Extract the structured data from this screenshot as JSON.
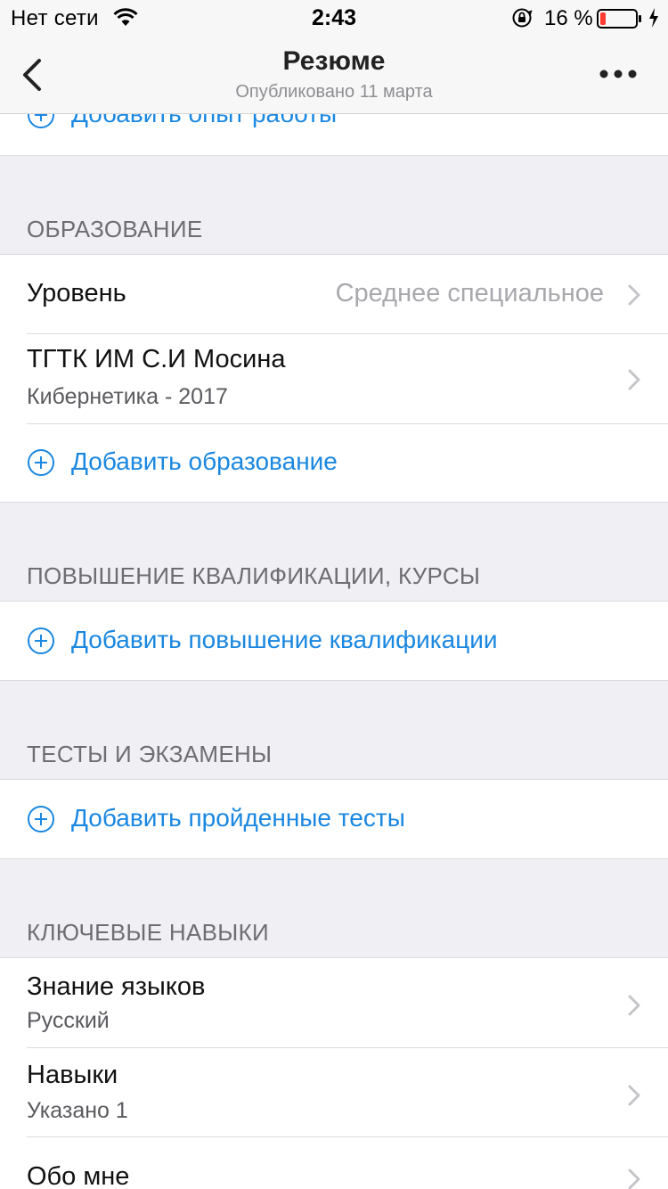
{
  "status": {
    "carrier": "Нет сети",
    "time": "2:43",
    "battery_percent": "16 %",
    "battery_level": 0.16,
    "battery_color": "#ff3b30"
  },
  "nav": {
    "title": "Резюме",
    "subtitle": "Опубликовано 11 марта"
  },
  "experience": {
    "add_label": "Добавить опыт работы"
  },
  "education": {
    "header": "ОБРАЗОВАНИЕ",
    "level_label": "Уровень",
    "level_value": "Среднее специальное",
    "institution_name": "ТГТК ИМ С.И Мосина",
    "institution_detail": "Кибернетика - 2017",
    "add_label": "Добавить образование"
  },
  "courses": {
    "header": "ПОВЫШЕНИЕ КВАЛИФИКАЦИИ, КУРСЫ",
    "add_label": "Добавить повышение квалификации"
  },
  "tests": {
    "header": "ТЕСТЫ И ЭКЗАМЕНЫ",
    "add_label": "Добавить пройденные тесты"
  },
  "skills": {
    "header": "КЛЮЧЕВЫЕ НАВЫКИ",
    "languages_label": "Знание языков",
    "languages_value": "Русский",
    "skills_label": "Навыки",
    "skills_value": "Указано 1",
    "about_label": "Обо мне"
  },
  "colors": {
    "accent": "#1a87e0",
    "background": "#efeff4"
  }
}
